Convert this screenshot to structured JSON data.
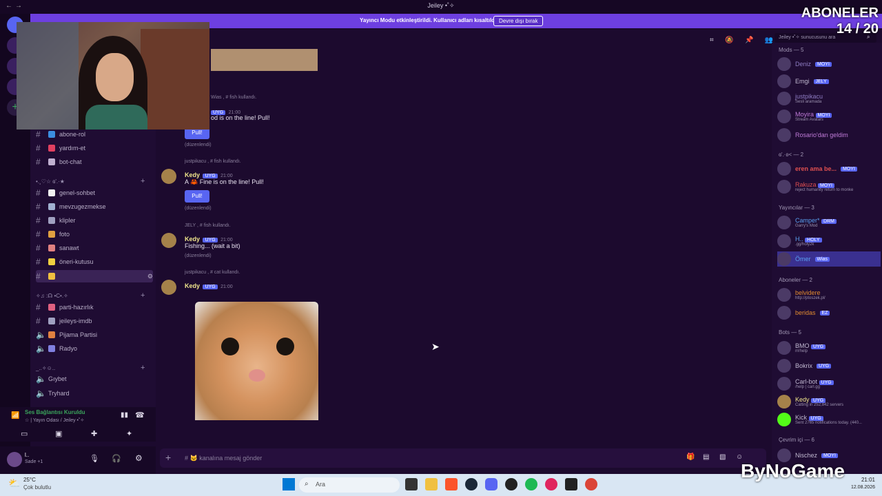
{
  "window": {
    "title": "Jeiley •˚✧"
  },
  "banner": {
    "text": "Yayıncı Modu etkinleştirildi. Kullanıcı adları kısaltıldı.",
    "button": "Devre dışı bırak"
  },
  "overlay": {
    "subs_title": "ABONELER",
    "subs_count": "14 / 20",
    "watermark": "ByNoGame"
  },
  "search": {
    "placeholder": "Jeiley •˚✧ sunucusunu ara"
  },
  "channels": [
    {
      "name": "abone-rol",
      "type": "text"
    },
    {
      "name": "yardım-et",
      "type": "text"
    },
    {
      "name": "bot-chat",
      "type": "text"
    },
    {
      "name": "genel-sohbet",
      "type": "text"
    },
    {
      "name": "mevzugezmekse",
      "type": "text"
    },
    {
      "name": "klipler",
      "type": "text"
    },
    {
      "name": "foto",
      "type": "text"
    },
    {
      "name": "sanawt",
      "type": "text"
    },
    {
      "name": "öneri-kutusu",
      "type": "text"
    },
    {
      "name": "",
      "type": "text"
    },
    {
      "name": "parti-hazırlık",
      "type": "text"
    },
    {
      "name": "jeileys-imdb",
      "type": "text"
    },
    {
      "name": "Pijama Partisi",
      "type": "voice"
    },
    {
      "name": "Radyo",
      "type": "voice"
    },
    {
      "name": "Gıybet",
      "type": "voice"
    },
    {
      "name": "Tryhard",
      "type": "voice"
    }
  ],
  "categories": {
    "c1": "•.¸♡☆ ɞ'.·★",
    "c2": "✧♫ :☊ •C•.✧",
    "c3": "_..✧☺.."
  },
  "voice": {
    "status": "Ses Bağlantısı Kuruldu",
    "room": "☆ | Yayın Odası / Jeiley •˚✧"
  },
  "user": {
    "name": "l..",
    "status": "Sade +1"
  },
  "messages": [
    {
      "reply": "Wias , # fish kullandı.",
      "name": "Kedy",
      "tag": "UYG",
      "time": "21:00",
      "text": "od is on the line! Pull!",
      "button": "Pull!",
      "edited": "(düzenlendi)"
    },
    {
      "reply": "justpikacu , # fish kullandı.",
      "name": "Kedy",
      "tag": "UYG",
      "time": "21:00",
      "text": "A 🦀 Fine is on the line! Pull!",
      "button": "Pull!",
      "edited": "(düzenlendi)"
    },
    {
      "reply": "JELY , # fish kullandı.",
      "name": "Kedy",
      "tag": "UYG",
      "time": "21:00",
      "text": "Fishing... (wait a bit)",
      "button": "",
      "edited": "(düzenlendi)"
    },
    {
      "reply": "justpikacu , # cat kullandı.",
      "name": "Kedy",
      "tag": "UYG",
      "time": "21:00",
      "text": "",
      "button": "",
      "edited": ""
    }
  ],
  "input": {
    "placeholder": "# 🐱 kanalına mesaj gönder"
  },
  "members": {
    "groups": [
      {
        "title": "Mods — 5",
        "items": [
          {
            "name": "Deniz",
            "tag": "MOYI",
            "sub": "",
            "color": "#8e7cc3"
          },
          {
            "name": "Emgi",
            "tag": "JELY",
            "sub": "",
            "color": "#c0b8d0"
          },
          {
            "name": "justpikacu",
            "tag": "",
            "sub": "Sesli aramada",
            "color": "#8e7cc3"
          },
          {
            "name": "Moyira",
            "tag": "MOYI",
            "sub": "Stream Avatars",
            "color": "#c07bd8"
          },
          {
            "name": "Rosario'dan geldim",
            "tag": "",
            "sub": "",
            "color": "#c07bd8"
          }
        ]
      },
      {
        "title": "ɞ'.·ʚ< — 2",
        "items": [
          {
            "name": "eren ama be...",
            "tag": "MOYI",
            "sub": "",
            "color": "#e05050"
          },
          {
            "name": "Rakuza",
            "tag": "MOYI",
            "sub": "reject humanity return to monke",
            "color": "#e05050"
          }
        ]
      },
      {
        "title": "Yayıncılar — 3",
        "items": [
          {
            "name": "Camper*",
            "tag": "DRM",
            "sub": "Garry's Mod",
            "color": "#5aa0f0"
          },
          {
            "name": "H..",
            "tag": "HOLY",
            "sub": ".gg/holy2k",
            "color": "#5aa0f0"
          },
          {
            "name": "Ömer",
            "tag": "Wias",
            "sub": "",
            "color": "#5aa0f0"
          }
        ]
      },
      {
        "title": "Aboneler — 2",
        "items": [
          {
            "name": "belvidere",
            "tag": "",
            "sub": "http://ptoszek.pl/",
            "color": "#e08a30"
          },
          {
            "name": "beridas",
            "tag": "EZ",
            "sub": "",
            "color": "#e08a30"
          }
        ]
      },
      {
        "title": "Bots — 5",
        "items": [
          {
            "name": "BMO",
            "tag": "UYG",
            "sub": "m!help",
            "color": "#c0b8d0"
          },
          {
            "name": "Bokrix",
            "tag": "UYG",
            "sub": "",
            "color": "#c0b8d0"
          },
          {
            "name": "Carl-bot",
            "tag": "UYG",
            "sub": "/help | carl.gg",
            "color": "#c0b8d0"
          },
          {
            "name": "Kedy",
            "tag": "UYG",
            "sub": "Catting in 252,842 servers",
            "color": "#f0e68c"
          },
          {
            "name": "Kick",
            "tag": "UYG",
            "sub": "Sent 2765 notifications today. (440...",
            "color": "#c0b8d0"
          }
        ]
      },
      {
        "title": "Çevrim içi — 6",
        "items": [
          {
            "name": "Nischez",
            "tag": "MOYI",
            "sub": "",
            "color": "#c0b8d0"
          }
        ]
      }
    ]
  },
  "taskbar": {
    "weather": "25°C",
    "weather_desc": "Çok bulutlu",
    "search": "Ara",
    "time": "21:01",
    "date": "12.08.2026"
  }
}
